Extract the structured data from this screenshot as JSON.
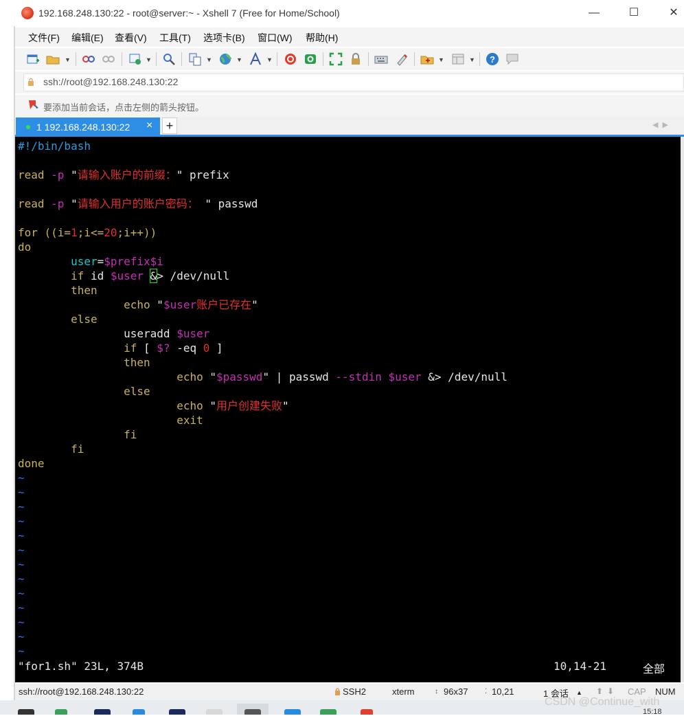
{
  "window": {
    "title": "192.168.248.130:22 - root@server:~ - Xshell 7 (Free for Home/School)",
    "minimize_glyph": "—",
    "maximize_glyph": "☐",
    "close_glyph": "✕"
  },
  "menu": [
    "文件(F)",
    "编辑(E)",
    "查看(V)",
    "工具(T)",
    "选项卡(B)",
    "窗口(W)",
    "帮助(H)"
  ],
  "toolbar_icons": [
    "new-session-icon",
    "open-folder-icon",
    "connect-icon",
    "disconnect-icon",
    "properties-icon",
    "search-icon",
    "copy-paste-icon",
    "globe-icon",
    "font-icon",
    "xshell-icon",
    "xftp-icon",
    "fullscreen-icon",
    "lock-icon",
    "keyboard-icon",
    "highlight-icon",
    "new-folder-icon",
    "layout-icon",
    "help-icon",
    "chat-icon"
  ],
  "address": {
    "value": "ssh://root@192.168.248.130:22"
  },
  "info": {
    "text": "要添加当前会话，点击左侧的箭头按钮。"
  },
  "tabs": [
    {
      "label": "1 192.168.248.130:22",
      "close": "×",
      "active": true
    }
  ],
  "new_tab_label": "+",
  "terminal": {
    "lines": [
      [
        {
          "t": "#!/bin/bash",
          "c": "c"
        }
      ],
      [],
      [
        {
          "t": "read ",
          "c": "k"
        },
        {
          "t": "-p ",
          "c": "m"
        },
        {
          "t": "\"",
          "c": "w"
        },
        {
          "t": "请输入账户的前缀：",
          "c": "s"
        },
        {
          "t": "\" prefix",
          "c": "w"
        }
      ],
      [],
      [
        {
          "t": "read ",
          "c": "k"
        },
        {
          "t": "-p ",
          "c": "m"
        },
        {
          "t": "\"",
          "c": "w"
        },
        {
          "t": "请输入用户的账户密码： ",
          "c": "s"
        },
        {
          "t": "\" passwd",
          "c": "w"
        }
      ],
      [],
      [
        {
          "t": "for ",
          "c": "k"
        },
        {
          "t": "((i=",
          "c": "k"
        },
        {
          "t": "1",
          "c": "s"
        },
        {
          "t": ";i<=",
          "c": "k"
        },
        {
          "t": "20",
          "c": "s"
        },
        {
          "t": ";i++))",
          "c": "k"
        }
      ],
      [
        {
          "t": "do",
          "c": "k"
        }
      ],
      [
        {
          "t": "        "
        },
        {
          "t": "user",
          "c": "cy"
        },
        {
          "t": "=",
          "c": "w"
        },
        {
          "t": "$prefix$i",
          "c": "m"
        }
      ],
      [
        {
          "t": "        "
        },
        {
          "t": "if ",
          "c": "k"
        },
        {
          "t": "id ",
          "c": "w"
        },
        {
          "t": "$user ",
          "c": "m"
        },
        {
          "t": "&",
          "c": "w",
          "cursor": true
        },
        {
          "t": "> /dev/null",
          "c": "w"
        }
      ],
      [
        {
          "t": "        "
        },
        {
          "t": "then",
          "c": "k"
        }
      ],
      [
        {
          "t": "                "
        },
        {
          "t": "echo ",
          "c": "k"
        },
        {
          "t": "\"",
          "c": "w"
        },
        {
          "t": "$user",
          "c": "m"
        },
        {
          "t": "账户已存在",
          "c": "s"
        },
        {
          "t": "\"",
          "c": "w"
        }
      ],
      [
        {
          "t": "        "
        },
        {
          "t": "else",
          "c": "k"
        }
      ],
      [
        {
          "t": "                "
        },
        {
          "t": "useradd ",
          "c": "w"
        },
        {
          "t": "$user",
          "c": "m"
        }
      ],
      [
        {
          "t": "                "
        },
        {
          "t": "if ",
          "c": "k"
        },
        {
          "t": "[ ",
          "c": "w"
        },
        {
          "t": "$? ",
          "c": "m"
        },
        {
          "t": "-eq ",
          "c": "w"
        },
        {
          "t": "0 ",
          "c": "s"
        },
        {
          "t": "]",
          "c": "w"
        }
      ],
      [
        {
          "t": "                "
        },
        {
          "t": "then",
          "c": "k"
        }
      ],
      [
        {
          "t": "                        "
        },
        {
          "t": "echo ",
          "c": "k"
        },
        {
          "t": "\"",
          "c": "w"
        },
        {
          "t": "$passwd",
          "c": "m"
        },
        {
          "t": "\" ",
          "c": "w"
        },
        {
          "t": "| passwd ",
          "c": "w"
        },
        {
          "t": "--stdin ",
          "c": "m"
        },
        {
          "t": "$user ",
          "c": "m"
        },
        {
          "t": "&> ",
          "c": "w"
        },
        {
          "t": "/dev/null",
          "c": "w"
        }
      ],
      [
        {
          "t": "                "
        },
        {
          "t": "else",
          "c": "k"
        }
      ],
      [
        {
          "t": "                        "
        },
        {
          "t": "echo ",
          "c": "k"
        },
        {
          "t": "\"",
          "c": "w"
        },
        {
          "t": "用户创建失败",
          "c": "s"
        },
        {
          "t": "\"",
          "c": "w"
        }
      ],
      [
        {
          "t": "                        "
        },
        {
          "t": "exit",
          "c": "k"
        }
      ],
      [
        {
          "t": "                "
        },
        {
          "t": "fi",
          "c": "k"
        }
      ],
      [
        {
          "t": "        "
        },
        {
          "t": "fi",
          "c": "k"
        }
      ],
      [
        {
          "t": "done",
          "c": "k"
        }
      ],
      [
        {
          "t": "~",
          "c": "tl"
        }
      ],
      [
        {
          "t": "~",
          "c": "tl"
        }
      ],
      [
        {
          "t": "~",
          "c": "tl"
        }
      ],
      [
        {
          "t": "~",
          "c": "tl"
        }
      ],
      [
        {
          "t": "~",
          "c": "tl"
        }
      ],
      [
        {
          "t": "~",
          "c": "tl"
        }
      ],
      [
        {
          "t": "~",
          "c": "tl"
        }
      ],
      [
        {
          "t": "~",
          "c": "tl"
        }
      ],
      [
        {
          "t": "~",
          "c": "tl"
        }
      ],
      [
        {
          "t": "~",
          "c": "tl"
        }
      ],
      [
        {
          "t": "~",
          "c": "tl"
        }
      ],
      [
        {
          "t": "~",
          "c": "tl"
        }
      ],
      [
        {
          "t": "~",
          "c": "tl"
        }
      ]
    ],
    "status_file": "\"for1.sh\" 23L, 374B",
    "status_pos": "10,14-21",
    "status_scope": "全部"
  },
  "statusbar": {
    "address": "ssh://root@192.168.248.130:22",
    "protocol": "SSH2",
    "term": "xterm",
    "size": "96x37",
    "cursor": "10,21",
    "sessions": "1 会话",
    "cap": "CAP",
    "num": "NUM"
  },
  "watermark": "CSDN @Continue_with",
  "clock": "15:18",
  "colors": {
    "accent_blue": "#2e8ee6",
    "terminal_bg": "#000000",
    "keyword": "#c9b25c",
    "string": "#e03030",
    "variable": "#c42fb5",
    "comment": "#2e9ae0",
    "tilde": "#3070f0"
  }
}
